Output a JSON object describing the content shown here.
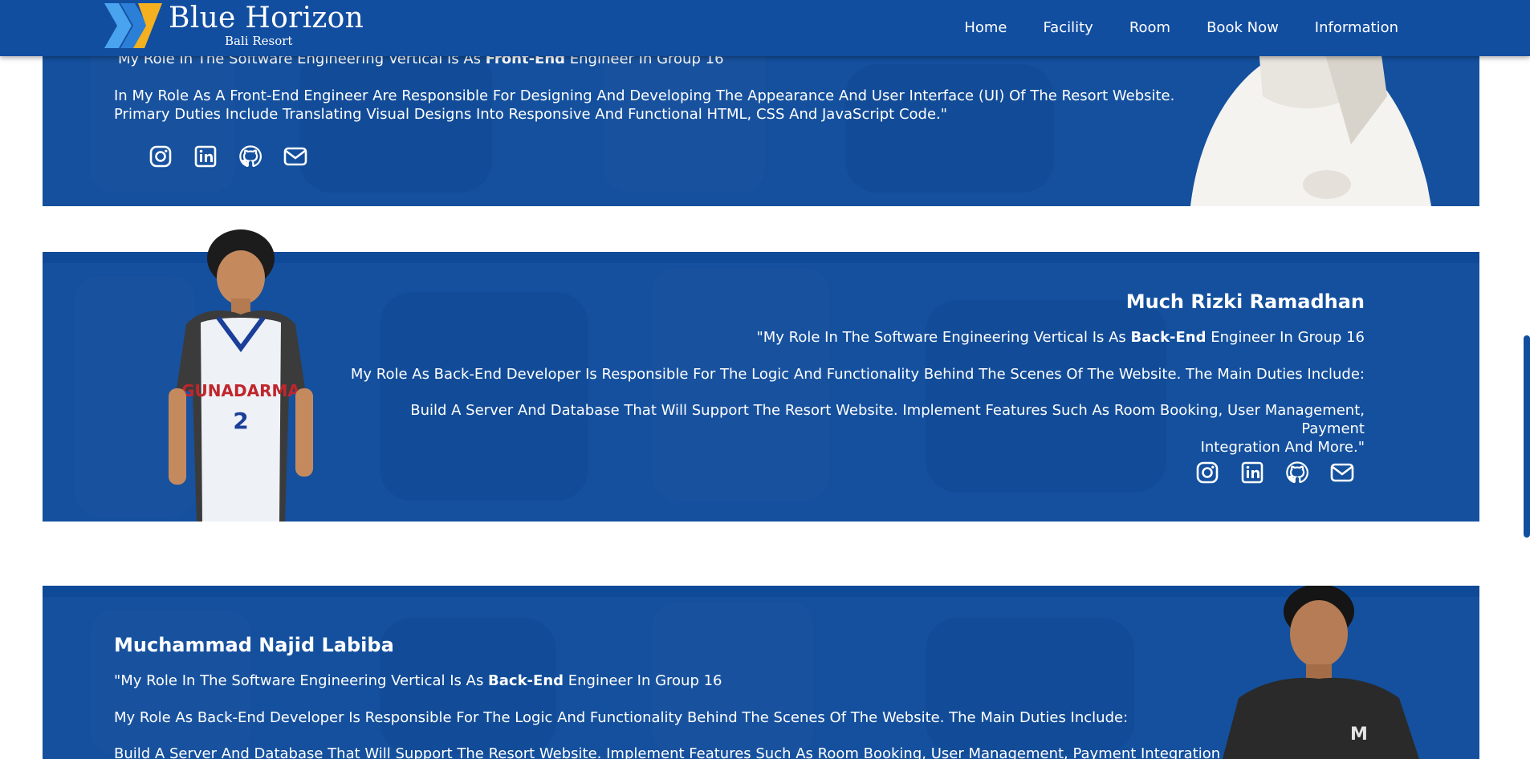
{
  "brand": {
    "title": "Blue Horizon",
    "subtitle": "Bali Resort"
  },
  "nav": {
    "items": [
      "Home",
      "Facility",
      "Room",
      "Book Now",
      "Information"
    ]
  },
  "members": [
    {
      "role_prefix": "My Role In The Software Engineering Vertical Is As ",
      "role_bold": "Front-End",
      "role_suffix": " Engineer In Group 16",
      "desc1": "In My Role As A Front-End Engineer Are Responsible For Designing And Developing The Appearance And User Interface (UI) Of The Resort Website.",
      "desc2": "Primary Duties Include Translating Visual Designs Into Responsive And Functional HTML, CSS And JavaScript Code.\""
    },
    {
      "name": "Much Rizki Ramadhan",
      "role_prefix": "\"My Role In The Software Engineering Vertical Is As ",
      "role_bold": "Back-End",
      "role_suffix": " Engineer In Group 16",
      "desc1": "My Role As Back-End Developer Is Responsible For The Logic And Functionality Behind The Scenes Of The Website. The Main Duties Include:",
      "desc2": "Build A Server And Database That Will Support The Resort Website. Implement Features Such As Room Booking, User Management, Payment",
      "desc3": "Integration And More.\""
    },
    {
      "name": "Muchammad Najid Labiba",
      "role_prefix": "\"My Role In The Software Engineering Vertical Is As ",
      "role_bold": "Back-End",
      "role_suffix": " Engineer In Group 16",
      "desc1": "My Role As Back-End Developer Is Responsible For The Logic And Functionality Behind The Scenes Of The Website. The Main Duties Include:",
      "desc2": "Build A Server And Database That Will Support The Resort Website. Implement Features Such As Room Booking, User Management, Payment Integration And"
    }
  ],
  "social_icons": [
    "instagram-icon",
    "linkedin-icon",
    "github-icon",
    "mail-icon"
  ],
  "colors": {
    "navbar": "#124ea0",
    "card": "#14509e",
    "accent_yellow": "#f5b01f",
    "accent_lightblue": "#4aa3ee"
  }
}
